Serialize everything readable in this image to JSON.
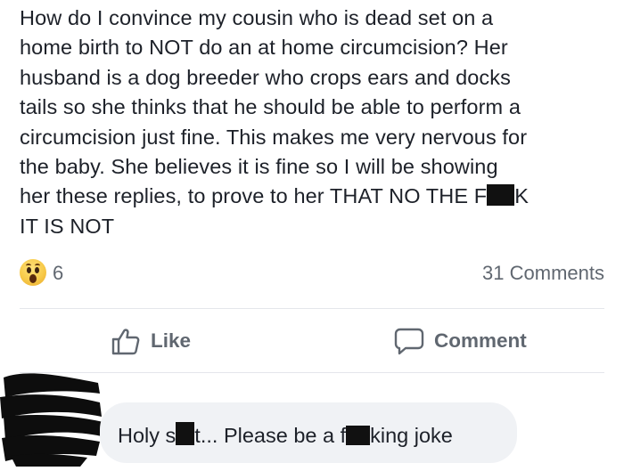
{
  "post": {
    "lines": [
      "How do I convince my cousin who is dead set on a",
      "home birth to NOT do an at home circumcision? Her",
      "husband is a dog breeder who crops ears and docks",
      "tails so she thinks that he should be able to perform a",
      "circumcision just fine. This makes me very nervous for",
      "the baby. She believes it is fine so I will be showing"
    ],
    "line7_before": "her these replies, to prove to her THAT NO THE F",
    "line7_after": "K",
    "line8": "IT IS NOT"
  },
  "reactions": {
    "icon": "wow-reaction-icon",
    "count": "6",
    "comments_count": "31 Comments"
  },
  "actions": {
    "like_label": "Like",
    "comment_label": "Comment"
  },
  "comment": {
    "part1": "Holy s",
    "part2": "t... Please be a f",
    "part3": "king joke"
  },
  "colors": {
    "text": "#1d2129",
    "secondary": "#606770",
    "bubble": "#f0f2f5",
    "redaction": "#111111",
    "divider": "#e4e6eb"
  }
}
